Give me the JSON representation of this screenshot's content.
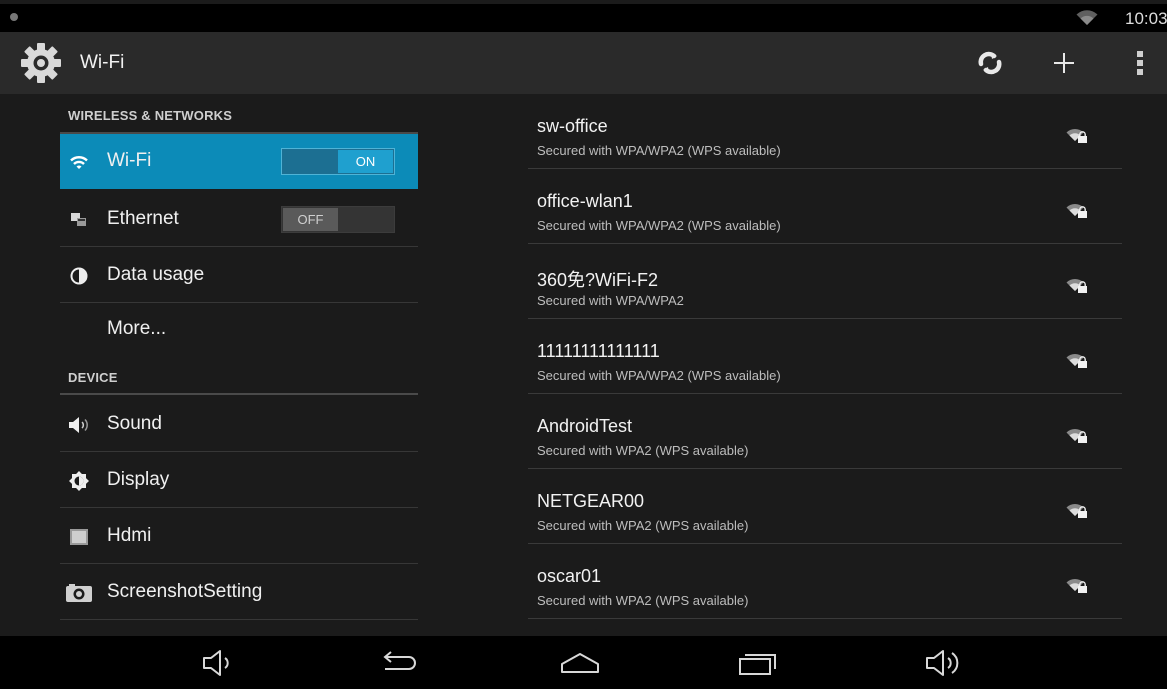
{
  "status_bar": {
    "time": "10:03"
  },
  "action_bar": {
    "title": "Wi-Fi",
    "actions": [
      "wps-icon",
      "add-icon",
      "overflow-menu-icon"
    ]
  },
  "settings": {
    "wireless_header": "WIRELESS & NETWORKS",
    "device_header": "DEVICE",
    "wifi": {
      "label": "Wi-Fi",
      "toggle": "ON",
      "selected": true
    },
    "ethernet": {
      "label": "Ethernet",
      "toggle": "OFF"
    },
    "data_usage": {
      "label": "Data usage"
    },
    "more": {
      "label": "More..."
    },
    "sound": {
      "label": "Sound"
    },
    "display": {
      "label": "Display"
    },
    "hdmi": {
      "label": "Hdmi"
    },
    "screenshot": {
      "label": "ScreenshotSetting"
    }
  },
  "networks": [
    {
      "ssid": "sw-office",
      "security": "Secured with WPA/WPA2 (WPS available)"
    },
    {
      "ssid": "office-wlan1",
      "security": "Secured with WPA/WPA2 (WPS available)"
    },
    {
      "ssid": "360免?WiFi-F2",
      "security": "Secured with WPA/WPA2"
    },
    {
      "ssid": "11111111111111",
      "security": "Secured with WPA/WPA2 (WPS available)"
    },
    {
      "ssid": "AndroidTest",
      "security": "Secured with WPA2 (WPS available)"
    },
    {
      "ssid": "NETGEAR00",
      "security": "Secured with WPA2 (WPS available)"
    },
    {
      "ssid": "oscar01",
      "security": "Secured with WPA2 (WPS available)"
    }
  ],
  "colors": {
    "accent": "#0c8bb8",
    "background": "#1b1b1b",
    "action_bar": "#2a2a2a"
  }
}
